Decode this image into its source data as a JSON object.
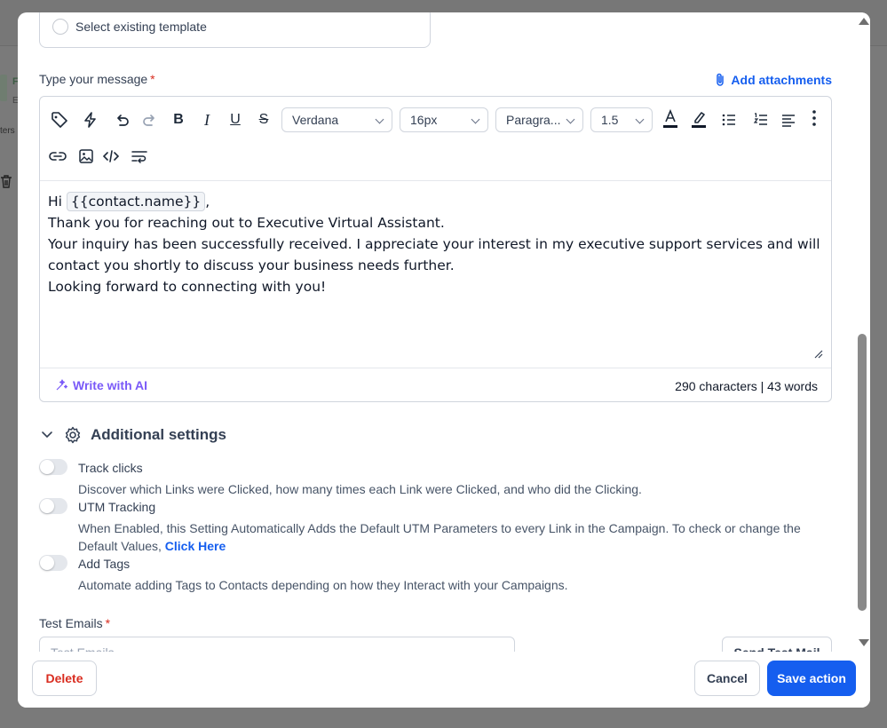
{
  "background": {
    "chip_letter": "F",
    "chip_sub": "E",
    "side_text": "ters"
  },
  "template": {
    "option_label": "Select existing template"
  },
  "message": {
    "label": "Type your message",
    "required_mark": "*",
    "attachments_label": "Add attachments"
  },
  "toolbar": {
    "font_family": "Verdana",
    "font_size": "16px",
    "block_format": "Paragra...",
    "line_height": "1.5",
    "icons": [
      "tag-icon",
      "lightning-icon",
      "undo-icon",
      "redo-icon",
      "bold-icon",
      "italic-icon",
      "underline-icon",
      "strikethrough-icon",
      "text-color-icon",
      "highlight-icon",
      "bullet-list-icon",
      "numbered-list-icon",
      "align-left-icon",
      "more-vertical-icon",
      "link-icon",
      "image-icon",
      "code-icon",
      "text-wrap-icon"
    ]
  },
  "editor": {
    "greeting": "Hi",
    "merge_tag": "{{contact.name}}",
    "greeting_suffix": ",",
    "line2": "Thank you for reaching out to Executive Virtual Assistant.",
    "line3": "Your inquiry has been successfully received. I appreciate your interest in my executive support services and will contact you shortly to discuss your business needs further.",
    "line4": "Looking forward to connecting with you!",
    "write_ai_label": "Write with AI",
    "counts": "290 characters | 43 words"
  },
  "settings": {
    "title": "Additional settings",
    "options": [
      {
        "title": "Track clicks",
        "desc": "Discover which Links were Clicked, how many times each Link were Clicked, and who did the Clicking.",
        "enabled": false
      },
      {
        "title": "UTM Tracking",
        "desc": "When Enabled, this Setting Automatically Adds the Default UTM Parameters to every Link in the Campaign. To check or change the Default Values,",
        "link": "Click Here",
        "enabled": false
      },
      {
        "title": "Add Tags",
        "desc": "Automate adding Tags to Contacts depending on how they Interact with your Campaigns.",
        "enabled": false
      }
    ]
  },
  "test_emails": {
    "label": "Test Emails",
    "required_mark": "*",
    "placeholder": "Test Emails",
    "send_label": "Send Test Mail"
  },
  "actions": {
    "delete_label": "Delete",
    "cancel_label": "Cancel",
    "save_label": "Save action"
  },
  "colors": {
    "primary": "#155eef",
    "danger": "#d92d20",
    "ai": "#7a5af8"
  }
}
